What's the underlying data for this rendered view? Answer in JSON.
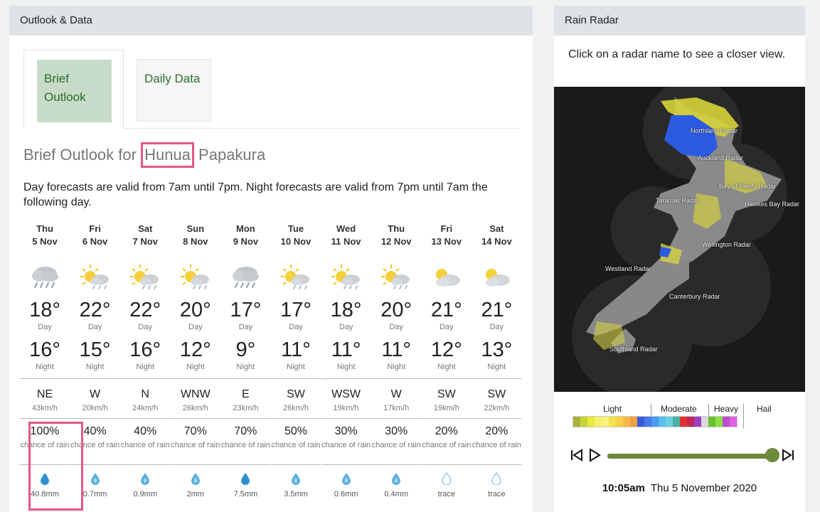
{
  "left_panel": {
    "header": "Outlook & Data"
  },
  "tabs": [
    {
      "label": "Brief Outlook"
    },
    {
      "label": "Daily Data"
    }
  ],
  "outlook": {
    "prefix": "Brief Outlook for",
    "highlight": "Hunua",
    "suffix": "Papakura",
    "description": "Day forecasts are valid from 7am until 7pm. Night forecasts are valid from 7pm until 7am the following day."
  },
  "labels": {
    "day": "Day",
    "night": "Night",
    "chance_of_rain": "chance of rain"
  },
  "days": [
    {
      "name": "Thu",
      "date": "5 Nov",
      "icon": "rain-icon",
      "day_temp": "18°",
      "night_temp": "16°",
      "wind_dir": "NE",
      "wind_speed": "43km/h",
      "rain_pct": "100%",
      "rain_amt": "40.8mm",
      "drop": "drop-solid"
    },
    {
      "name": "Fri",
      "date": "6 Nov",
      "icon": "sun-cloud-icon",
      "day_temp": "22°",
      "night_temp": "15°",
      "wind_dir": "W",
      "wind_speed": "20km/h",
      "rain_pct": "40%",
      "rain_amt": "0.7mm",
      "drop": "drop-light"
    },
    {
      "name": "Sat",
      "date": "7 Nov",
      "icon": "sun-cloud-icon",
      "day_temp": "22°",
      "night_temp": "16°",
      "wind_dir": "N",
      "wind_speed": "24km/h",
      "rain_pct": "40%",
      "rain_amt": "0.9mm",
      "drop": "drop-light"
    },
    {
      "name": "Sun",
      "date": "8 Nov",
      "icon": "sun-cloud-icon",
      "day_temp": "20°",
      "night_temp": "12°",
      "wind_dir": "WNW",
      "wind_speed": "26km/h",
      "rain_pct": "70%",
      "rain_amt": "2mm",
      "drop": "drop-light"
    },
    {
      "name": "Mon",
      "date": "9 Nov",
      "icon": "rain-icon",
      "day_temp": "17°",
      "night_temp": "9°",
      "wind_dir": "E",
      "wind_speed": "23km/h",
      "rain_pct": "70%",
      "rain_amt": "7.5mm",
      "drop": "drop-solid"
    },
    {
      "name": "Tue",
      "date": "10 Nov",
      "icon": "sun-cloud-icon",
      "day_temp": "17°",
      "night_temp": "11°",
      "wind_dir": "SW",
      "wind_speed": "26km/h",
      "rain_pct": "50%",
      "rain_amt": "3.5mm",
      "drop": "drop-light"
    },
    {
      "name": "Wed",
      "date": "11 Nov",
      "icon": "sun-cloud-icon",
      "day_temp": "18°",
      "night_temp": "11°",
      "wind_dir": "WSW",
      "wind_speed": "19km/h",
      "rain_pct": "30%",
      "rain_amt": "0.6mm",
      "drop": "drop-light"
    },
    {
      "name": "Thu",
      "date": "12 Nov",
      "icon": "sun-cloud-icon",
      "day_temp": "20°",
      "night_temp": "11°",
      "wind_dir": "W",
      "wind_speed": "17km/h",
      "rain_pct": "30%",
      "rain_amt": "0.4mm",
      "drop": "drop-light"
    },
    {
      "name": "Fri",
      "date": "13 Nov",
      "icon": "partly-cloudy-icon",
      "day_temp": "21°",
      "night_temp": "12°",
      "wind_dir": "SW",
      "wind_speed": "19km/h",
      "rain_pct": "20%",
      "rain_amt": "trace",
      "drop": "drop-outline"
    },
    {
      "name": "Sat",
      "date": "14 Nov",
      "icon": "partly-cloudy-icon",
      "day_temp": "21°",
      "night_temp": "13°",
      "wind_dir": "SW",
      "wind_speed": "22km/h",
      "rain_pct": "20%",
      "rain_amt": "trace",
      "drop": "drop-outline"
    }
  ],
  "radar": {
    "header": "Rain Radar",
    "note": "Click on a radar name to see a closer view.",
    "radars": [
      "Northland Radar",
      "Auckland Radar",
      "Bay of Plenty Radar",
      "Taranaki Radar",
      "Hawkes Bay Radar",
      "Wellington Radar",
      "Westland Radar",
      "Canterbury Radar",
      "Southland Radar"
    ],
    "legend": {
      "light": "Light",
      "moderate": "Moderate",
      "heavy": "Heavy",
      "hail": "Hail"
    },
    "legend_colors": [
      "#a8b23a",
      "#c8d23a",
      "#e8ea3a",
      "#f4f06a",
      "#f8f27c",
      "#f4e24a",
      "#f8d048",
      "#f8b848",
      "#f0a040",
      "#3a5ad8",
      "#4a7ae8",
      "#4a9af0",
      "#5ac0f0",
      "#6ad0e0",
      "#4ab0a8",
      "#e03030",
      "#c02858",
      "#a040c0",
      "#d8d8e0",
      "#6ac030",
      "#8ae040",
      "#c04ad0",
      "#e060e0"
    ],
    "time": "10:05am",
    "date": "Thu 5 November 2020",
    "progress": 1.0
  }
}
